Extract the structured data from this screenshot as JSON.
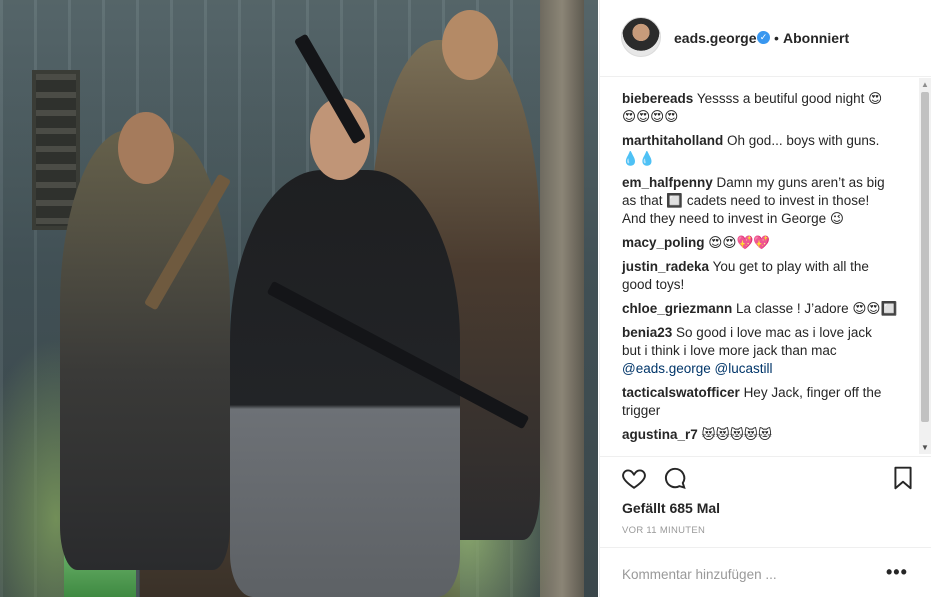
{
  "post": {
    "image_alt": "",
    "author": {
      "handle": "eads.george",
      "verified_icon": "verified-badge-icon",
      "separator": "•",
      "follow_status": "Abonniert"
    },
    "comments": [
      {
        "user": "biebereads",
        "text": "Yessss a beutiful good night 😍",
        "text2": "😍😍😍😍"
      },
      {
        "user": "marthitaholland",
        "text": "Oh god... boys with guns.",
        "text2": "💧💧"
      },
      {
        "user": "em_halfpenny",
        "text": "Damn my guns aren’t as big",
        "text2": "as that 🔲 cadets need to invest in those!",
        "text3": "And they need to invest in George 😉"
      },
      {
        "user": "macy_poling",
        "text": "😍😍💖💖"
      },
      {
        "user": "justin_radeka",
        "text": "You get to play with all the",
        "text2": "good toys!"
      },
      {
        "user": "chloe_griezmann",
        "text": "La classe ! J’adore 😍😍🔲"
      },
      {
        "user": "benia23",
        "text": "So good i love mac as i love jack",
        "text2": "but i think i love more jack than mac",
        "mentions": "@eads.george @lucastill"
      },
      {
        "user": "tacticalswatofficer",
        "text": "Hey Jack, finger off the",
        "text2": "trigger"
      },
      {
        "user": "agustina_r7",
        "text": "😻😻😻😻😻"
      }
    ],
    "icons": {
      "like": "heart-icon",
      "comment": "comment-bubble-icon",
      "save": "bookmark-icon",
      "options": "more-options-icon"
    },
    "likes": "Gefällt 685 Mal",
    "timestamp": "VOR 11 MINUTEN",
    "comment_input": {
      "placeholder": "Kommentar hinzufügen ...",
      "value": ""
    },
    "options_label": "•••"
  }
}
